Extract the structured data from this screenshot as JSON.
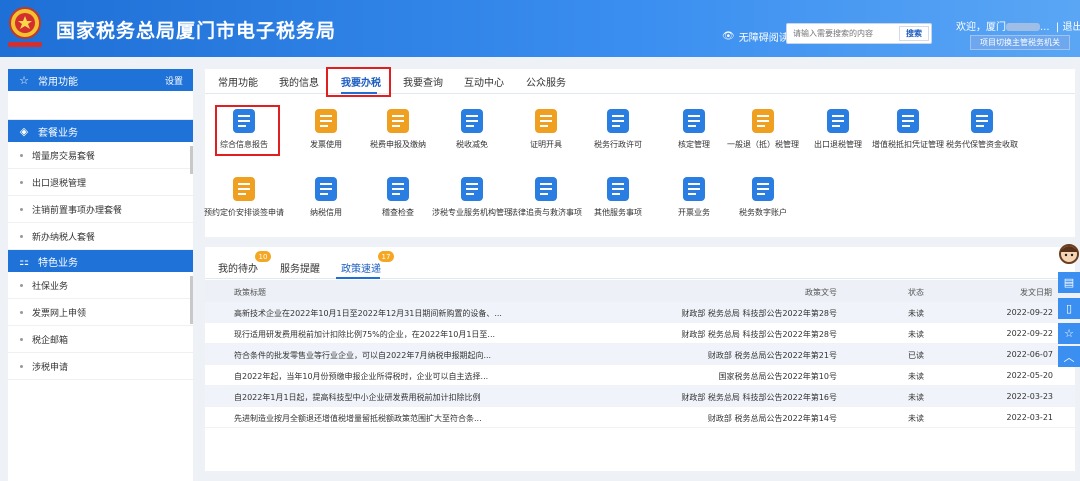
{
  "header": {
    "title": "国家税务总局厦门市电子税务局",
    "accessibility": "无障碍阅读",
    "search_placeholder": "请输入需要搜索的内容",
    "search_button": "搜索",
    "welcome_prefix": "欢迎，厦门",
    "welcome_suffix": "...",
    "logout": "退出",
    "switch_button": "项目切换主管税务机关"
  },
  "sidebar": {
    "common": {
      "title": "常用功能",
      "settings": "设置"
    },
    "package": {
      "title": "套餐业务",
      "items": [
        "增量房交易套餐",
        "出口退税管理",
        "注销前置事项办理套餐",
        "新办纳税人套餐"
      ]
    },
    "special": {
      "title": "特色业务",
      "items": [
        "社保业务",
        "发票网上申领",
        "税企邮箱",
        "涉税申请"
      ]
    }
  },
  "main_tabs": [
    "常用功能",
    "我的信息",
    "我要办税",
    "我要查询",
    "互动中心",
    "公众服务"
  ],
  "functions": [
    "综合信息报告",
    "发票使用",
    "税费申报及缴纳",
    "税收减免",
    "证明开具",
    "税务行政许可",
    "核定管理",
    "一般退（抵）税管理",
    "出口退税管理",
    "增值税抵扣凭证管理",
    "税务代保管资金收取",
    "预约定价安排谈签申请",
    "纳税信用",
    "稽查检查",
    "涉税专业服务机构管理",
    "法律追责与救济事项",
    "其他服务事项",
    "开票业务",
    "税务数字账户"
  ],
  "lower_tabs": [
    {
      "label": "我的待办",
      "badge": "10"
    },
    {
      "label": "服务提醒",
      "badge": ""
    },
    {
      "label": "政策速递",
      "badge": "17"
    }
  ],
  "table": {
    "headers": [
      "政策标题",
      "政策文号",
      "状态",
      "发文日期"
    ],
    "rows": [
      [
        "高新技术企业在2022年10月1日至2022年12月31日期间新购置的设备、...",
        "财政部 税务总局 科技部公告2022年第28号",
        "未读",
        "2022-09-22"
      ],
      [
        "现行适用研发费用税前加计扣除比例75%的企业，在2022年10月1日至...",
        "财政部 税务总局 科技部公告2022年第28号",
        "未读",
        "2022-09-22"
      ],
      [
        "符合条件的批发零售业等行业企业，可以自2022年7月纳税申报期起向...",
        "财政部 税务总局公告2022年第21号",
        "已读",
        "2022-06-07"
      ],
      [
        "自2022年起，当年10月份预缴申报企业所得税时，企业可以自主选择...",
        "国家税务总局公告2022年第10号",
        "未读",
        "2022-05-20"
      ],
      [
        "自2022年1月1日起，提高科技型中小企业研发费用税前加计扣除比例",
        "财政部 税务总局 科技部公告2022年第16号",
        "未读",
        "2022-03-23"
      ],
      [
        "先进制造业按月全额退还增值税增量留抵税额政策范围扩大至符合条...",
        "财政部 税务总局公告2022年第14号",
        "未读",
        "2022-03-21"
      ]
    ]
  },
  "colors": {
    "primary": "#1e6fd6",
    "highlight": "#e02020",
    "badge": "#f5a623"
  }
}
